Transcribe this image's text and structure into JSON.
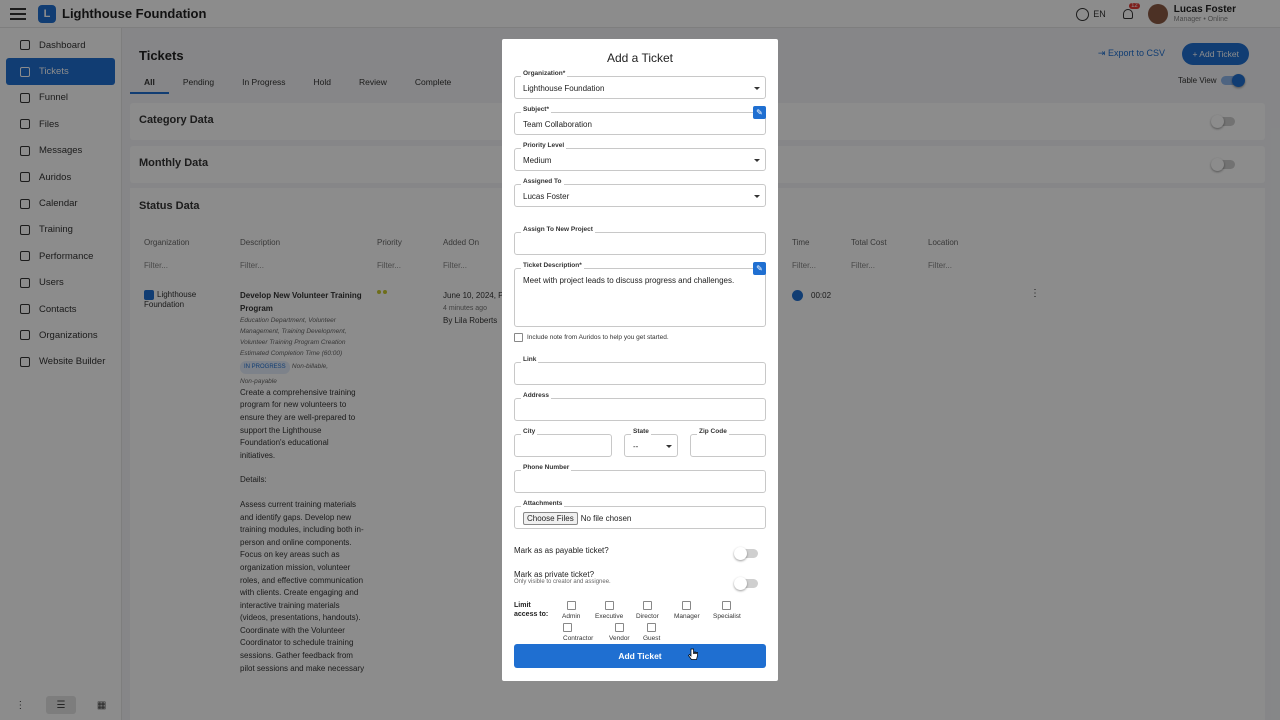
{
  "app": {
    "brand": "Lighthouse Foundation",
    "brand_initial": "L"
  },
  "topbar": {
    "lang": "EN",
    "notifications": "12",
    "user_name": "Lucas Foster",
    "user_role": "Manager • Online"
  },
  "sidebar": {
    "items": [
      {
        "label": "Dashboard",
        "icon": "grid-icon"
      },
      {
        "label": "Tickets",
        "icon": "tag-icon",
        "active": true
      },
      {
        "label": "Funnel",
        "icon": "funnel-icon"
      },
      {
        "label": "Files",
        "icon": "file-icon"
      },
      {
        "label": "Messages",
        "icon": "chat-icon"
      },
      {
        "label": "Auridos",
        "icon": "audio-icon"
      },
      {
        "label": "Calendar",
        "icon": "calendar-icon"
      },
      {
        "label": "Training",
        "icon": "training-icon"
      },
      {
        "label": "Performance",
        "icon": "performance-icon"
      },
      {
        "label": "Users",
        "icon": "user-icon"
      },
      {
        "label": "Contacts",
        "icon": "contacts-icon"
      },
      {
        "label": "Organizations",
        "icon": "organization-icon"
      },
      {
        "label": "Website Builder",
        "icon": "website-icon"
      }
    ]
  },
  "main": {
    "title": "Tickets",
    "export_label": "Export to CSV",
    "add_label": "+ Add Ticket",
    "tabs": [
      "All",
      "Pending",
      "In Progress",
      "Hold",
      "Review",
      "Complete"
    ],
    "table_view_label": "Table View",
    "sections": [
      "Category Data",
      "Monthly Data",
      "Status Data"
    ],
    "columns": [
      "Organization",
      "Description",
      "Priority",
      "Added On",
      "Time",
      "Total Cost",
      "Location"
    ],
    "filter_placeholder": "Filter...",
    "row": {
      "org": "Lighthouse Foundation",
      "title": "Develop New Volunteer Training Program",
      "meta": "Education Department, Volunteer Management, Training Development, Volunteer Training Program Creation Estimated Completion Time (60:00)",
      "status": "IN PROGRESS",
      "billable": "Non-billable,",
      "payable": "Non-payable",
      "body": "Create a comprehensive training program for new volunteers to ensure they are well-prepared to support the Lighthouse Foundation's educational initiatives.",
      "details_head": "Details:",
      "details": "Assess current training materials and identify gaps. Develop new training modules, including both in-person and online components. Focus on key areas such as organization mission, volunteer roles, and effective communication with clients. Create engaging and interactive training materials (videos, presentations, handouts). Coordinate with the Volunteer Coordinator to schedule training sessions. Gather feedback from pilot sessions and make necessary",
      "added_on": "June 10, 2024, PM",
      "added_ago": "4 minutes ago",
      "added_by": "By Lila Roberts",
      "time": "00:02"
    }
  },
  "modal": {
    "title": "Add a Ticket",
    "organization": {
      "label": "Organization*",
      "value": "Lighthouse Foundation"
    },
    "subject": {
      "label": "Subject*",
      "value": "Team Collaboration"
    },
    "priority": {
      "label": "Priority Level",
      "value": "Medium"
    },
    "assigned": {
      "label": "Assigned To",
      "value": "Lucas Foster"
    },
    "project": {
      "label": "Assign To New Project",
      "value": ""
    },
    "description": {
      "label": "Ticket Description*",
      "value": "Meet with project leads to discuss progress and challenges."
    },
    "note_label": "Include note from Auridos to help you get started.",
    "link_label": "Link",
    "address_label": "Address",
    "city_label": "City",
    "state": {
      "label": "State",
      "value": "--"
    },
    "zip_label": "Zip Code",
    "phone_label": "Phone Number",
    "attachments": {
      "label": "Attachments",
      "button": "Choose Files",
      "status": "No file chosen"
    },
    "payable_label": "Mark as as payable ticket?",
    "private_label": "Mark as private ticket?",
    "private_sub": "Only visible to creator and assignee.",
    "limit_label": "Limit access to:",
    "roles": [
      "Admin",
      "Executive",
      "Director",
      "Manager",
      "Specialist",
      "Contractor",
      "Vendor",
      "Guest"
    ],
    "submit_label": "Add Ticket"
  }
}
